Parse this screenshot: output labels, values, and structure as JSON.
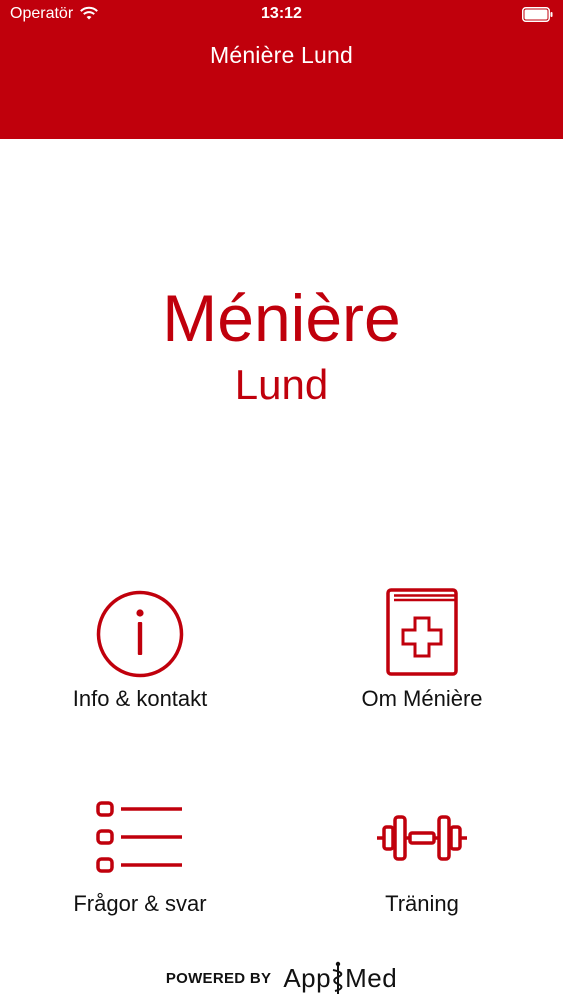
{
  "status_bar": {
    "carrier": "Operatör",
    "time": "13:12",
    "wifi_icon": "wifi-icon",
    "battery_icon": "battery-icon"
  },
  "nav": {
    "title": "Ménière Lund"
  },
  "logo": {
    "title": "Ménière",
    "subtitle": "Lund"
  },
  "menu": {
    "items": [
      {
        "label": "Info & kontakt",
        "icon": "info-icon"
      },
      {
        "label": "Om Ménière",
        "icon": "medical-book-icon"
      },
      {
        "label": "Frågor & svar",
        "icon": "list-icon"
      },
      {
        "label": "Träning",
        "icon": "dumbbell-icon"
      }
    ]
  },
  "footer": {
    "powered_by": "POWERED BY",
    "brand_left": "App",
    "brand_right": "Med"
  },
  "colors": {
    "accent": "#c0000c",
    "text": "#111111",
    "background": "#ffffff"
  }
}
